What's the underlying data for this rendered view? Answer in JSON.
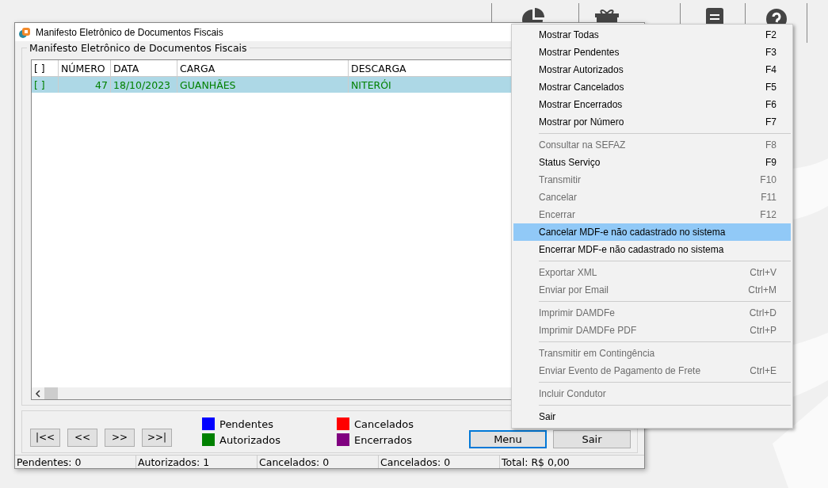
{
  "window": {
    "title": "Manifesto Eletrônico de Documentos Fiscais"
  },
  "group": {
    "title": "Manifesto Eletrônico de Documentos Fiscais"
  },
  "table": {
    "columns": [
      "[ ]",
      "NÚMERO",
      "DATA",
      "CARGA",
      "DESCARGA"
    ],
    "rows": [
      {
        "check": "[ ]",
        "numero": "47",
        "data": "18/10/2023",
        "carga": "GUANHÃES",
        "descarga": "NITERÓI",
        "color": "#008000",
        "selected": true
      }
    ]
  },
  "nav_buttons": [
    "|<<",
    "<<",
    ">>",
    ">>|"
  ],
  "legend": [
    {
      "label": "Pendentes",
      "color": "#0000ff"
    },
    {
      "label": "Cancelados",
      "color": "#ff0000"
    },
    {
      "label": "Autorizados",
      "color": "#008000"
    },
    {
      "label": "Encerrados",
      "color": "#800080"
    }
  ],
  "buttons": [
    {
      "label": "Menu",
      "focused": true
    },
    {
      "label": "Sair",
      "focused": false
    }
  ],
  "status_bar": [
    "Pendentes: 0",
    "Autorizados: 1",
    "Cancelados: 0",
    "Cancelados: 0",
    "Total: R$ 0,00"
  ],
  "menu": [
    {
      "kind": "item",
      "label": "Mostrar Todas",
      "shortcut": "F2",
      "disabled": false,
      "selected": false
    },
    {
      "kind": "item",
      "label": "Mostrar Pendentes",
      "shortcut": "F3",
      "disabled": false,
      "selected": false
    },
    {
      "kind": "item",
      "label": "Mostrar Autorizados",
      "shortcut": "F4",
      "disabled": false,
      "selected": false
    },
    {
      "kind": "item",
      "label": "Mostrar Cancelados",
      "shortcut": "F5",
      "disabled": false,
      "selected": false
    },
    {
      "kind": "item",
      "label": "Mostrar Encerrados",
      "shortcut": "F6",
      "disabled": false,
      "selected": false
    },
    {
      "kind": "item",
      "label": "Mostrar por Número",
      "shortcut": "F7",
      "disabled": false,
      "selected": false
    },
    {
      "kind": "separator"
    },
    {
      "kind": "item",
      "label": "Consultar na SEFAZ",
      "shortcut": "F8",
      "disabled": true,
      "selected": false
    },
    {
      "kind": "item",
      "label": "Status Serviço",
      "shortcut": "F9",
      "disabled": false,
      "selected": false
    },
    {
      "kind": "item",
      "label": "Transmitir",
      "shortcut": "F10",
      "disabled": true,
      "selected": false
    },
    {
      "kind": "item",
      "label": "Cancelar",
      "shortcut": "F11",
      "disabled": true,
      "selected": false
    },
    {
      "kind": "item",
      "label": "Encerrar",
      "shortcut": "F12",
      "disabled": true,
      "selected": false
    },
    {
      "kind": "item",
      "label": "Cancelar MDF-e não cadastrado no sistema",
      "disabled": false,
      "selected": true
    },
    {
      "kind": "item",
      "label": "Encerrar MDF-e não cadastrado no sistema",
      "disabled": false,
      "selected": false
    },
    {
      "kind": "separator"
    },
    {
      "kind": "item",
      "label": "Exportar XML",
      "shortcut": "Ctrl+V",
      "disabled": true,
      "selected": false
    },
    {
      "kind": "item",
      "label": "Enviar por Email",
      "shortcut": "Ctrl+M",
      "disabled": true,
      "selected": false
    },
    {
      "kind": "separator"
    },
    {
      "kind": "item",
      "label": "Imprimir DAMDFe",
      "shortcut": "Ctrl+D",
      "disabled": true,
      "selected": false
    },
    {
      "kind": "item",
      "label": "Imprimir DAMDFe PDF",
      "shortcut": "Ctrl+P",
      "disabled": true,
      "selected": false
    },
    {
      "kind": "separator"
    },
    {
      "kind": "item",
      "label": "Transmitir em Contingência",
      "disabled": true,
      "selected": false
    },
    {
      "kind": "item",
      "label": "Enviar Evento de Pagamento de Frete",
      "shortcut": "Ctrl+E",
      "disabled": true,
      "selected": false
    },
    {
      "kind": "separator"
    },
    {
      "kind": "item",
      "label": "Incluir Condutor",
      "disabled": true,
      "selected": false
    },
    {
      "kind": "separator"
    },
    {
      "kind": "item",
      "label": "Sair",
      "disabled": false,
      "selected": false
    }
  ]
}
